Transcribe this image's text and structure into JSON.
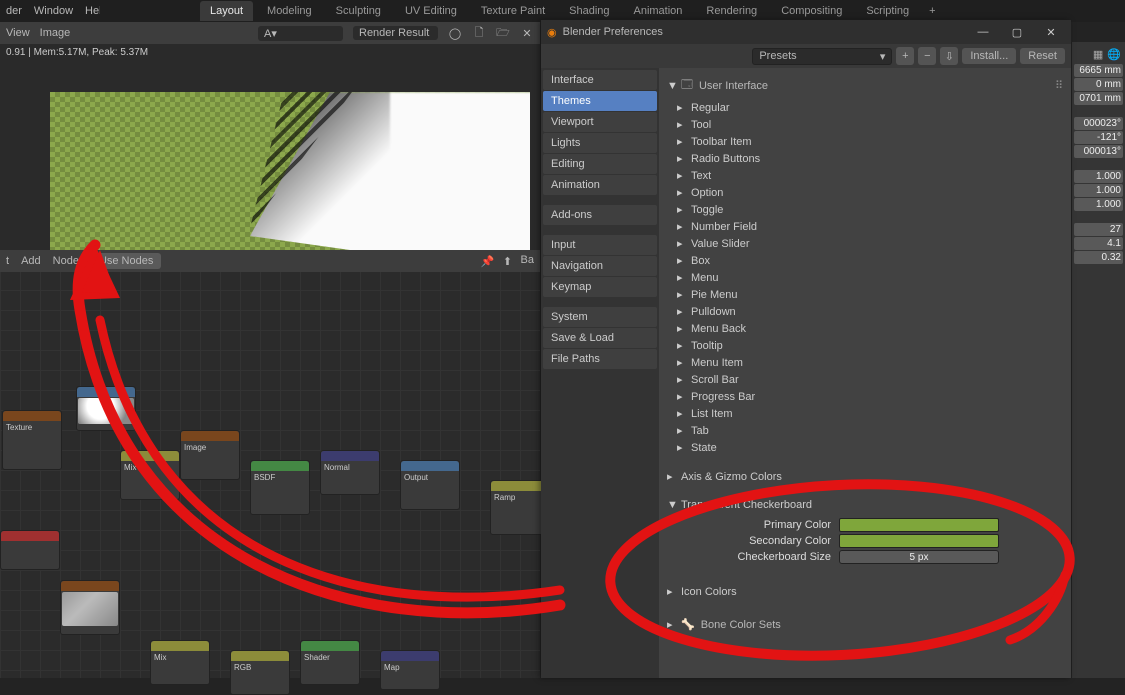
{
  "topbar": {
    "menu": [
      "der",
      "Window",
      "Help"
    ]
  },
  "workspaces": {
    "tabs": [
      "Layout",
      "Modeling",
      "Sculpting",
      "UV Editing",
      "Texture Paint",
      "Shading",
      "Animation",
      "Rendering",
      "Compositing",
      "Scripting"
    ],
    "active": 0,
    "add": "+"
  },
  "image_editor": {
    "menu_view": "View",
    "menu_image": "Image",
    "name_field": "Render Result",
    "view_type_icon": "A",
    "status": "0.91 | Mem:5.17M, Peak: 5.37M"
  },
  "node_editor": {
    "menu": [
      "t",
      "Add",
      "Node"
    ],
    "use_nodes": "Use Nodes",
    "back": "Ba"
  },
  "prefs": {
    "title": "Blender Preferences",
    "presets_label": "Presets",
    "install_label": "Install...",
    "reset_label": "Reset",
    "sidebar": [
      {
        "label": "Interface"
      },
      {
        "label": "Themes",
        "active": true
      },
      {
        "label": "Viewport"
      },
      {
        "label": "Lights"
      },
      {
        "label": "Editing"
      },
      {
        "label": "Animation"
      },
      {
        "gap": true
      },
      {
        "label": "Add-ons"
      },
      {
        "gap": true
      },
      {
        "label": "Input"
      },
      {
        "label": "Navigation"
      },
      {
        "label": "Keymap"
      },
      {
        "gap": true
      },
      {
        "label": "System"
      },
      {
        "label": "Save & Load"
      },
      {
        "label": "File Paths"
      }
    ],
    "ui_section": "User Interface",
    "rows": [
      "Regular",
      "Tool",
      "Toolbar Item",
      "Radio Buttons",
      "Text",
      "Option",
      "Toggle",
      "Number Field",
      "Value Slider",
      "Box",
      "Menu",
      "Pie Menu",
      "Pulldown",
      "Menu Back",
      "Tooltip",
      "Menu Item",
      "Scroll Bar",
      "Progress Bar",
      "List Item",
      "Tab",
      "State"
    ],
    "axis_label": "Axis & Gizmo Colors",
    "transparent_label": "Transparent Checkerboard",
    "checker": {
      "primary_label": "Primary Color",
      "secondary_label": "Secondary Color",
      "size_label": "Checkerboard Size",
      "size_value": "5 px",
      "primary_color": "#81a53e",
      "secondary_color": "#81a53e"
    },
    "icon_colors_label": "Icon Colors",
    "bone_colors_label": "Bone Color Sets"
  },
  "props": {
    "rows": [
      "6665 mm",
      "0 mm",
      "0701 mm",
      "",
      "000023°",
      "-121°",
      "000013°",
      "",
      "1.000",
      "1.000",
      "1.000",
      "",
      "27",
      "4.1",
      "0.32"
    ]
  }
}
